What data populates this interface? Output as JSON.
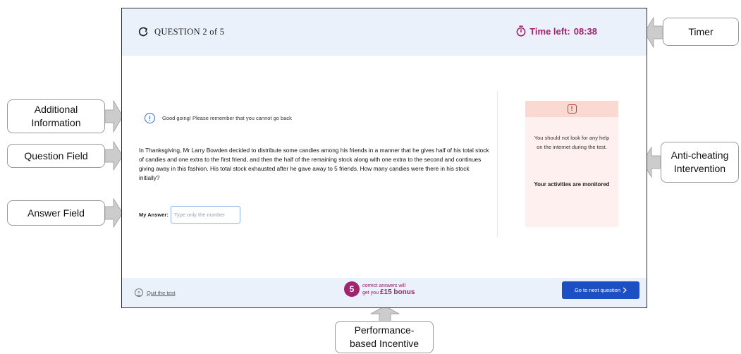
{
  "header": {
    "question_counter": "QUESTION 2 of 5",
    "timer_label": "Time left:",
    "timer_value": "08:38"
  },
  "info_message": "Good going! Please remember that you cannot go back",
  "question_text": "In Thanksgiving, Mr Larry Bowden decided to distribute some candies among his friends in a manner that he gives half of his total stock of candies and one extra to the first friend, and then the half of the remaining stock along with one extra to the second and continues giving away in this fashion. His total stock exhausted after he gave away to 5 friends. How many candies were there in his stock initially?",
  "answer": {
    "label": "My Answer:",
    "placeholder": "Type only the number",
    "value": ""
  },
  "warning": {
    "icon_glyph": "!",
    "text": "You should not look for any help on the internet during the test.",
    "bold_text": "Your activities are monitored"
  },
  "footer": {
    "quit_label": "Quit the test",
    "incentive_count": "5",
    "incentive_line1": "correct answers will",
    "incentive_line2": "get you",
    "incentive_bonus": "£15 bonus",
    "next_label": "Go to next question"
  },
  "annotations": {
    "timer": "Timer",
    "additional_info_line1": "Additional",
    "additional_info_line2": "Information",
    "question_field": "Question Field",
    "answer_field": "Answer Field",
    "anti_cheating_line1": "Anti-cheating",
    "anti_cheating_line2": "Intervention",
    "incentive_line1": "Performance-",
    "incentive_line2": "based Incentive"
  },
  "colors": {
    "accent": "#a1246e",
    "primary_button": "#1d4fc4",
    "bar_background": "#eaf1fb",
    "warning_background": "#fdf0ee",
    "warning_header": "#fbd9d3",
    "info_blue": "#2f6ccf"
  },
  "icons": {
    "question_counter": "refresh-icon",
    "timer": "stopwatch-icon",
    "info": "info-icon",
    "warning": "alert-icon",
    "quit": "close-circle-icon",
    "next": "chevron-right-icon"
  }
}
